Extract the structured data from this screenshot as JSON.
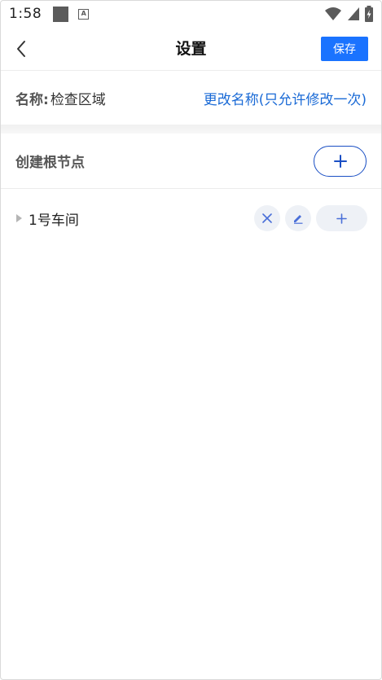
{
  "status_bar": {
    "time": "1:58",
    "icons": [
      "notification-square-icon",
      "a-badge-icon",
      "wifi-icon",
      "signal-icon",
      "battery-charging-icon"
    ]
  },
  "nav": {
    "title": "设置",
    "save_label": "保存",
    "accent_color": "#1a73ff"
  },
  "name_row": {
    "label": "名称:",
    "value": "检查区域",
    "rename_link": "更改名称(只允许修改一次)"
  },
  "root_row": {
    "label": "创建根节点",
    "add_icon": "plus-icon"
  },
  "tree": {
    "nodes": [
      {
        "label": "1号车间",
        "expand_icon": "caret-right-icon",
        "actions": [
          "close-icon",
          "edit-icon",
          "plus-icon"
        ]
      }
    ]
  }
}
